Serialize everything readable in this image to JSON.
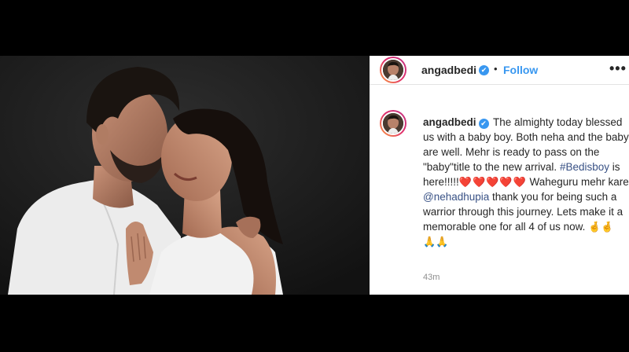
{
  "post": {
    "username": "angadbedi",
    "verified_glyph": "✔",
    "separator": "•",
    "follow_label": "Follow",
    "more_icon": "•••",
    "caption": {
      "username": "angadbedi",
      "text_part1": " The almighty today blessed us with a baby boy. Both neha and the baby are well. Mehr is ready to pass on the \"baby\"title to the new arrival.",
      "hashtag": "#Bedisboy",
      "text_part2": " is here!!!!!",
      "hearts": "❤️❤️❤️❤️❤️",
      "text_part3": " Waheguru mehr kare ",
      "mention": "@nehadhupia",
      "text_part4": " thank you for being such a warrior through this journey. Lets make it a memorable one for all 4 of us now. ",
      "emoji_fingers": "🤞🤞",
      "emoji_pray": "🙏🙏"
    },
    "timestamp": "43m"
  },
  "colors": {
    "link": "#385185",
    "follow": "#3897f0",
    "heart": "#e0122a",
    "timestamp": "#8e8e8e"
  },
  "icons": {
    "verified": "verified-badge-icon",
    "more": "more-options-icon"
  }
}
